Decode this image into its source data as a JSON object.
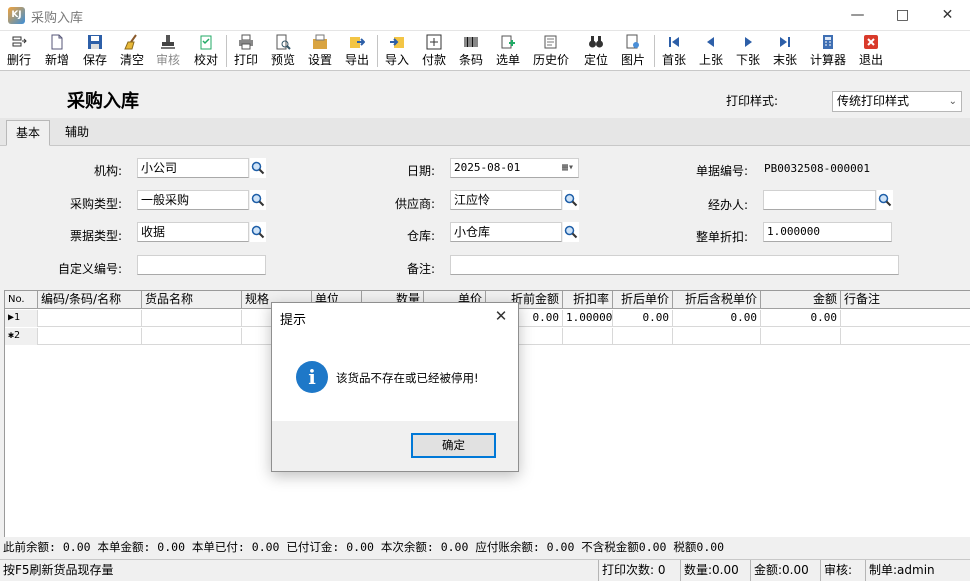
{
  "window": {
    "title": "采购入库",
    "app_icon_text": "KJ"
  },
  "toolbar": {
    "items": [
      {
        "label": "删行",
        "icon": "delete-row-icon",
        "disabled": false
      },
      {
        "label": "新增",
        "icon": "new-document-icon",
        "disabled": false
      },
      {
        "label": "保存",
        "icon": "save-disk-icon",
        "disabled": false
      },
      {
        "label": "清空",
        "icon": "broom-icon",
        "disabled": false
      },
      {
        "label": "审核",
        "icon": "stamp-icon",
        "disabled": true
      },
      {
        "label": "校对",
        "icon": "check-list-icon",
        "disabled": false
      },
      {
        "label": "打印",
        "icon": "printer-icon",
        "disabled": false
      },
      {
        "label": "预览",
        "icon": "preview-icon",
        "disabled": false
      },
      {
        "label": "设置",
        "icon": "settings-icon",
        "disabled": false
      },
      {
        "label": "导出",
        "icon": "export-icon",
        "disabled": false
      },
      {
        "label": "导入",
        "icon": "import-icon",
        "disabled": false
      },
      {
        "label": "付款",
        "icon": "payment-icon",
        "disabled": false
      },
      {
        "label": "条码",
        "icon": "barcode-icon",
        "disabled": false
      },
      {
        "label": "选单",
        "icon": "select-order-icon",
        "disabled": false
      },
      {
        "label": "历史价",
        "icon": "price-history-icon",
        "disabled": false
      },
      {
        "label": "定位",
        "icon": "binoculars-icon",
        "disabled": false
      },
      {
        "label": "图片",
        "icon": "picture-icon",
        "disabled": false
      },
      {
        "label": "首张",
        "icon": "first-record-icon",
        "disabled": false
      },
      {
        "label": "上张",
        "icon": "previous-record-icon",
        "disabled": false
      },
      {
        "label": "下张",
        "icon": "next-record-icon",
        "disabled": false
      },
      {
        "label": "末张",
        "icon": "last-record-icon",
        "disabled": false
      },
      {
        "label": "计算器",
        "icon": "calculator-icon",
        "disabled": false
      },
      {
        "label": "退出",
        "icon": "exit-icon",
        "disabled": false
      }
    ]
  },
  "header": {
    "form_title": "采购入库",
    "print_style_label": "打印样式:",
    "print_style_value": "传统打印样式"
  },
  "tabs": [
    {
      "label": "基本",
      "active": true
    },
    {
      "label": "辅助",
      "active": false
    }
  ],
  "form": {
    "org_label": "机构:",
    "org_value": "小公司",
    "purchase_type_label": "采购类型:",
    "purchase_type_value": "一般采购",
    "bill_type_label": "票据类型:",
    "bill_type_value": "收据",
    "custom_no_label": "自定义编号:",
    "custom_no_value": "",
    "date_label": "日期:",
    "date_value": "2025-08-01",
    "supplier_label": "供应商:",
    "supplier_value": "江应怜",
    "warehouse_label": "仓库:",
    "warehouse_value": "小仓库",
    "remark_label": "备注:",
    "remark_value": "",
    "doc_no_label": "单据编号:",
    "doc_no_value": "PB0032508-000001",
    "handler_label": "经办人:",
    "handler_value": "",
    "discount_label": "整单折扣:",
    "discount_value": "1.000000"
  },
  "grid": {
    "columns": [
      "No.",
      "编码/条码/名称",
      "货品名称",
      "规格",
      "单位",
      "数量",
      "单价",
      "折前金额",
      "折扣率",
      "折后单价",
      "折后含税单价",
      "金额",
      "行备注"
    ],
    "rows": [
      {
        "no": "▶1",
        "cells": [
          "",
          "",
          "",
          "",
          "",
          "",
          "0.00",
          "1.00000",
          "0.00",
          "0.00",
          "0.00",
          ""
        ]
      },
      {
        "no": "✱2",
        "cells": [
          "",
          "",
          "",
          "",
          "",
          "",
          "",
          "",
          "",
          "",
          "",
          ""
        ]
      }
    ]
  },
  "summary": "此前余额: 0.00 本单金额: 0.00 本单已付: 0.00 已付订金: 0.00 本次余额: 0.00 应付账余额: 0.00 不含税金额0.00 税额0.00",
  "status": {
    "hint": "按F5刷新货品现存量",
    "print_count": "打印次数: 0",
    "quantity": "数量:0.00",
    "amount": "金额:0.00",
    "audit": "审核:",
    "creator": "制单:admin"
  },
  "dialog": {
    "title": "提示",
    "message": "该货品不存在或已经被停用!",
    "ok_label": "确定"
  },
  "colors": {
    "accent": "#0078d7",
    "info_icon": "#1e78c8"
  }
}
